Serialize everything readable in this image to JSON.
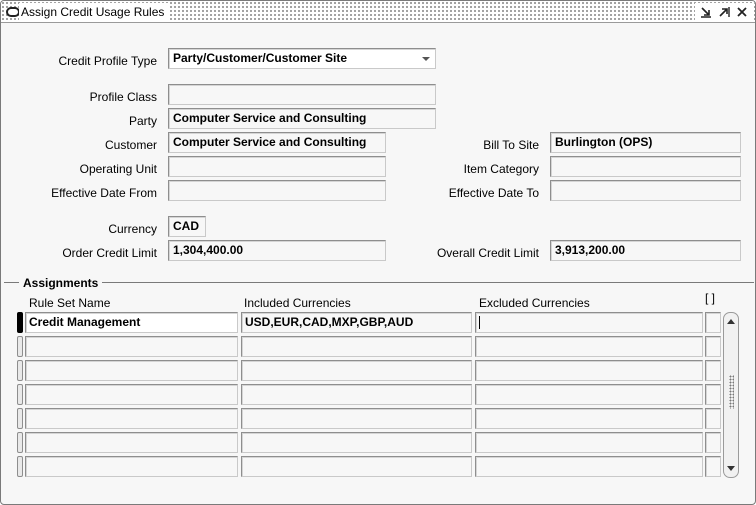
{
  "window": {
    "title": "Assign Credit Usage Rules"
  },
  "form": {
    "credit_profile_type": {
      "label": "Credit Profile Type",
      "value": "Party/Customer/Customer Site"
    },
    "profile_class": {
      "label": "Profile Class",
      "value": ""
    },
    "party": {
      "label": "Party",
      "value": "Computer Service and Consulting"
    },
    "customer": {
      "label": "Customer",
      "value": "Computer Service and Consulting"
    },
    "bill_to_site": {
      "label": "Bill To Site",
      "value": "Burlington (OPS)"
    },
    "operating_unit": {
      "label": "Operating Unit",
      "value": ""
    },
    "item_category": {
      "label": "Item Category",
      "value": ""
    },
    "effective_date_from": {
      "label": "Effective Date From",
      "value": ""
    },
    "effective_date_to": {
      "label": "Effective Date To",
      "value": ""
    },
    "currency": {
      "label": "Currency",
      "value": "CAD"
    },
    "order_credit_limit": {
      "label": "Order Credit Limit",
      "value": "1,304,400.00"
    },
    "overall_credit_limit": {
      "label": "Overall Credit Limit",
      "value": "3,913,200.00"
    }
  },
  "assignments": {
    "title": "Assignments",
    "columns": [
      "Rule Set Name",
      "Included Currencies",
      "Excluded Currencies",
      "[ ]"
    ],
    "rows": [
      {
        "rule_set_name": "Credit Management",
        "included": "USD,EUR,CAD,MXP,GBP,AUD",
        "excluded": ""
      },
      {
        "rule_set_name": "",
        "included": "",
        "excluded": ""
      },
      {
        "rule_set_name": "",
        "included": "",
        "excluded": ""
      },
      {
        "rule_set_name": "",
        "included": "",
        "excluded": ""
      },
      {
        "rule_set_name": "",
        "included": "",
        "excluded": ""
      },
      {
        "rule_set_name": "",
        "included": "",
        "excluded": ""
      },
      {
        "rule_set_name": "",
        "included": "",
        "excluded": ""
      }
    ]
  },
  "icons": {
    "window_menu": "window-menu-icon",
    "minimize": "minimize-icon",
    "maximize": "maximize-icon",
    "close": "close-icon",
    "dropdown": "chevron-down-icon"
  }
}
